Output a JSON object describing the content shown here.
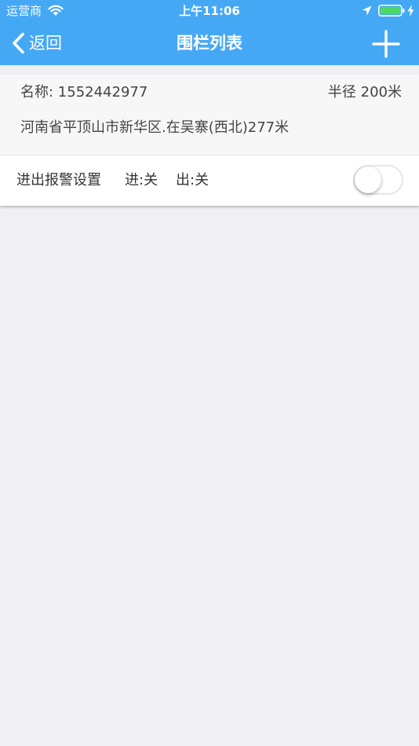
{
  "status_bar": {
    "carrier": "运营商",
    "time": "上午11:06",
    "icons": [
      "wifi-icon",
      "location-arrow-icon",
      "battery-icon",
      "charging-bolt-icon"
    ],
    "battery_color": "#4cd964"
  },
  "nav": {
    "back_label": "返回",
    "title": "围栏列表",
    "back_icon": "chevron-left-icon",
    "add_icon": "plus-icon",
    "background_color": "#45a8f5"
  },
  "fences": [
    {
      "name": "名称: 1552442977",
      "radius": "半径 200米",
      "address": "河南省平顶山市新华区.在吴寨(西北)277米",
      "alarm": {
        "label": "进出报警设置",
        "in_status": "进:关",
        "out_status": "出:关",
        "enabled": false
      }
    }
  ]
}
